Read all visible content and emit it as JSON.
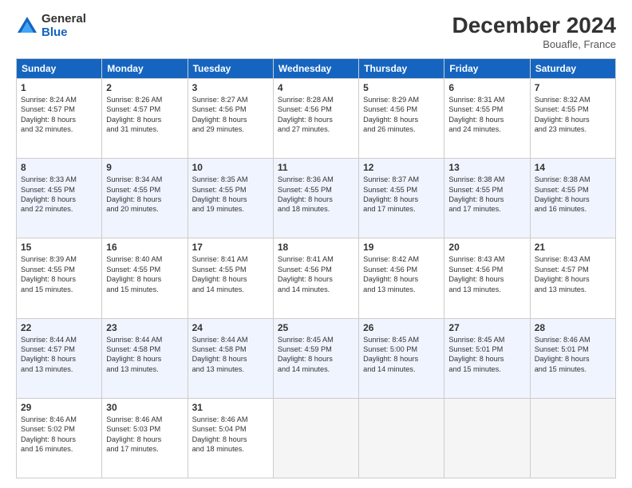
{
  "header": {
    "logo_general": "General",
    "logo_blue": "Blue",
    "month_title": "December 2024",
    "location": "Bouafle, France"
  },
  "days_of_week": [
    "Sunday",
    "Monday",
    "Tuesday",
    "Wednesday",
    "Thursday",
    "Friday",
    "Saturday"
  ],
  "weeks": [
    [
      {
        "day": "1",
        "lines": [
          "Sunrise: 8:24 AM",
          "Sunset: 4:57 PM",
          "Daylight: 8 hours",
          "and 32 minutes."
        ]
      },
      {
        "day": "2",
        "lines": [
          "Sunrise: 8:26 AM",
          "Sunset: 4:57 PM",
          "Daylight: 8 hours",
          "and 31 minutes."
        ]
      },
      {
        "day": "3",
        "lines": [
          "Sunrise: 8:27 AM",
          "Sunset: 4:56 PM",
          "Daylight: 8 hours",
          "and 29 minutes."
        ]
      },
      {
        "day": "4",
        "lines": [
          "Sunrise: 8:28 AM",
          "Sunset: 4:56 PM",
          "Daylight: 8 hours",
          "and 27 minutes."
        ]
      },
      {
        "day": "5",
        "lines": [
          "Sunrise: 8:29 AM",
          "Sunset: 4:56 PM",
          "Daylight: 8 hours",
          "and 26 minutes."
        ]
      },
      {
        "day": "6",
        "lines": [
          "Sunrise: 8:31 AM",
          "Sunset: 4:55 PM",
          "Daylight: 8 hours",
          "and 24 minutes."
        ]
      },
      {
        "day": "7",
        "lines": [
          "Sunrise: 8:32 AM",
          "Sunset: 4:55 PM",
          "Daylight: 8 hours",
          "and 23 minutes."
        ]
      }
    ],
    [
      {
        "day": "8",
        "lines": [
          "Sunrise: 8:33 AM",
          "Sunset: 4:55 PM",
          "Daylight: 8 hours",
          "and 22 minutes."
        ]
      },
      {
        "day": "9",
        "lines": [
          "Sunrise: 8:34 AM",
          "Sunset: 4:55 PM",
          "Daylight: 8 hours",
          "and 20 minutes."
        ]
      },
      {
        "day": "10",
        "lines": [
          "Sunrise: 8:35 AM",
          "Sunset: 4:55 PM",
          "Daylight: 8 hours",
          "and 19 minutes."
        ]
      },
      {
        "day": "11",
        "lines": [
          "Sunrise: 8:36 AM",
          "Sunset: 4:55 PM",
          "Daylight: 8 hours",
          "and 18 minutes."
        ]
      },
      {
        "day": "12",
        "lines": [
          "Sunrise: 8:37 AM",
          "Sunset: 4:55 PM",
          "Daylight: 8 hours",
          "and 17 minutes."
        ]
      },
      {
        "day": "13",
        "lines": [
          "Sunrise: 8:38 AM",
          "Sunset: 4:55 PM",
          "Daylight: 8 hours",
          "and 17 minutes."
        ]
      },
      {
        "day": "14",
        "lines": [
          "Sunrise: 8:38 AM",
          "Sunset: 4:55 PM",
          "Daylight: 8 hours",
          "and 16 minutes."
        ]
      }
    ],
    [
      {
        "day": "15",
        "lines": [
          "Sunrise: 8:39 AM",
          "Sunset: 4:55 PM",
          "Daylight: 8 hours",
          "and 15 minutes."
        ]
      },
      {
        "day": "16",
        "lines": [
          "Sunrise: 8:40 AM",
          "Sunset: 4:55 PM",
          "Daylight: 8 hours",
          "and 15 minutes."
        ]
      },
      {
        "day": "17",
        "lines": [
          "Sunrise: 8:41 AM",
          "Sunset: 4:55 PM",
          "Daylight: 8 hours",
          "and 14 minutes."
        ]
      },
      {
        "day": "18",
        "lines": [
          "Sunrise: 8:41 AM",
          "Sunset: 4:56 PM",
          "Daylight: 8 hours",
          "and 14 minutes."
        ]
      },
      {
        "day": "19",
        "lines": [
          "Sunrise: 8:42 AM",
          "Sunset: 4:56 PM",
          "Daylight: 8 hours",
          "and 13 minutes."
        ]
      },
      {
        "day": "20",
        "lines": [
          "Sunrise: 8:43 AM",
          "Sunset: 4:56 PM",
          "Daylight: 8 hours",
          "and 13 minutes."
        ]
      },
      {
        "day": "21",
        "lines": [
          "Sunrise: 8:43 AM",
          "Sunset: 4:57 PM",
          "Daylight: 8 hours",
          "and 13 minutes."
        ]
      }
    ],
    [
      {
        "day": "22",
        "lines": [
          "Sunrise: 8:44 AM",
          "Sunset: 4:57 PM",
          "Daylight: 8 hours",
          "and 13 minutes."
        ]
      },
      {
        "day": "23",
        "lines": [
          "Sunrise: 8:44 AM",
          "Sunset: 4:58 PM",
          "Daylight: 8 hours",
          "and 13 minutes."
        ]
      },
      {
        "day": "24",
        "lines": [
          "Sunrise: 8:44 AM",
          "Sunset: 4:58 PM",
          "Daylight: 8 hours",
          "and 13 minutes."
        ]
      },
      {
        "day": "25",
        "lines": [
          "Sunrise: 8:45 AM",
          "Sunset: 4:59 PM",
          "Daylight: 8 hours",
          "and 14 minutes."
        ]
      },
      {
        "day": "26",
        "lines": [
          "Sunrise: 8:45 AM",
          "Sunset: 5:00 PM",
          "Daylight: 8 hours",
          "and 14 minutes."
        ]
      },
      {
        "day": "27",
        "lines": [
          "Sunrise: 8:45 AM",
          "Sunset: 5:01 PM",
          "Daylight: 8 hours",
          "and 15 minutes."
        ]
      },
      {
        "day": "28",
        "lines": [
          "Sunrise: 8:46 AM",
          "Sunset: 5:01 PM",
          "Daylight: 8 hours",
          "and 15 minutes."
        ]
      }
    ],
    [
      {
        "day": "29",
        "lines": [
          "Sunrise: 8:46 AM",
          "Sunset: 5:02 PM",
          "Daylight: 8 hours",
          "and 16 minutes."
        ]
      },
      {
        "day": "30",
        "lines": [
          "Sunrise: 8:46 AM",
          "Sunset: 5:03 PM",
          "Daylight: 8 hours",
          "and 17 minutes."
        ]
      },
      {
        "day": "31",
        "lines": [
          "Sunrise: 8:46 AM",
          "Sunset: 5:04 PM",
          "Daylight: 8 hours",
          "and 18 minutes."
        ]
      },
      null,
      null,
      null,
      null
    ]
  ]
}
